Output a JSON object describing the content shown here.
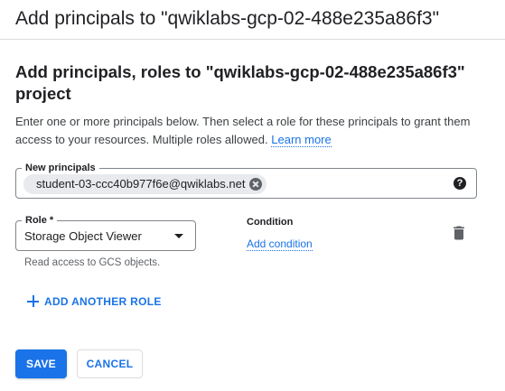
{
  "header": {
    "title": "Add principals to \"qwiklabs-gcp-02-488e235a86f3\""
  },
  "main": {
    "section_title": "Add principals, roles to \"qwiklabs-gcp-02-488e235a86f3\" project",
    "description": "Enter one or more principals below. Then select a role for these principals to grant them access to your resources. Multiple roles allowed.",
    "learn_more": "Learn more",
    "principals": {
      "label": "New principals",
      "chips": [
        "student-03-ccc40b977f6e@qwiklabs.net"
      ]
    },
    "role": {
      "label": "Role *",
      "value": "Storage Object Viewer",
      "hint": "Read access to GCS objects."
    },
    "condition": {
      "title": "Condition",
      "add_label": "Add condition"
    },
    "add_another_role": "ADD ANOTHER ROLE"
  },
  "actions": {
    "save": "SAVE",
    "cancel": "CANCEL"
  },
  "icons": {
    "help": "help-circle-icon",
    "chip_remove": "cancel-circle-icon",
    "dropdown": "arrow-drop-down-icon",
    "delete": "trash-icon",
    "add": "plus-icon"
  },
  "colors": {
    "accent": "#1a73e8",
    "text": "#202124",
    "secondary_text": "#5f6368",
    "border": "#80868b",
    "chip_bg": "#e8eaed"
  }
}
